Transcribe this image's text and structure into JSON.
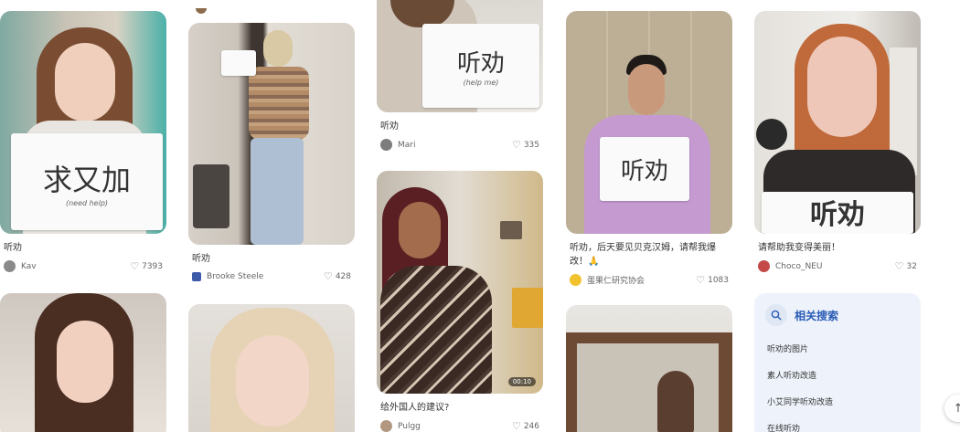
{
  "cards": [
    {
      "title": "听劝",
      "author": "Kav",
      "likes": "7393",
      "sign_text": "求又加",
      "sign_sub": "(need help)"
    },
    {
      "title": "听劝",
      "author": "Brooke Steele",
      "likes": "428",
      "sign_text": "",
      "sign_sub": ""
    },
    {
      "title": "听劝",
      "author": "Mari",
      "likes": "335",
      "sign_text": "听劝",
      "sign_sub": "(help me)"
    },
    {
      "title": "给外国人的建议?",
      "author": "Pulgg",
      "likes": "246",
      "duration": "00:10"
    },
    {
      "title": "听劝，后天要见贝克汉姆，请帮我爆改！🙏",
      "author": "蛋果仁研究协会",
      "likes": "1083",
      "sign_text": "听劝",
      "duration": ""
    },
    {
      "title": "请帮助我变得美丽！",
      "author": "Choco_NEU",
      "likes": "32",
      "sign_text": "听劝"
    }
  ],
  "related_search": {
    "title": "相关搜索",
    "items": [
      "听劝的图片",
      "素人听劝改造",
      "小艾同学听劝改造",
      "在线听劝"
    ]
  },
  "scroll_top_icon": "arrow-up-icon",
  "colors": {
    "accent": "#2a5bb5",
    "related_bg": "#eef3fb"
  }
}
